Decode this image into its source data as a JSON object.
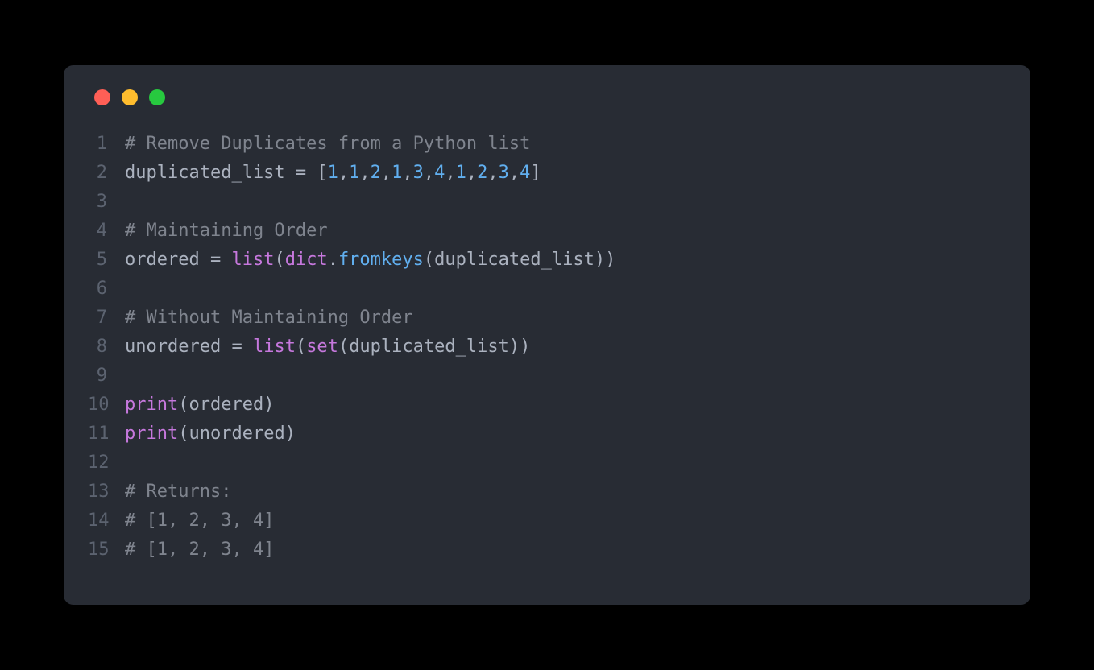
{
  "code": {
    "lines": [
      {
        "num": "1",
        "tokens": [
          {
            "cls": "tok-comment",
            "text": "# Remove Duplicates from a Python list"
          }
        ]
      },
      {
        "num": "2",
        "tokens": [
          {
            "cls": "tok-identifier",
            "text": "duplicated_list "
          },
          {
            "cls": "tok-operator",
            "text": "= "
          },
          {
            "cls": "tok-bracket",
            "text": "["
          },
          {
            "cls": "tok-number",
            "text": "1"
          },
          {
            "cls": "tok-operator",
            "text": ","
          },
          {
            "cls": "tok-number",
            "text": "1"
          },
          {
            "cls": "tok-operator",
            "text": ","
          },
          {
            "cls": "tok-number",
            "text": "2"
          },
          {
            "cls": "tok-operator",
            "text": ","
          },
          {
            "cls": "tok-number",
            "text": "1"
          },
          {
            "cls": "tok-operator",
            "text": ","
          },
          {
            "cls": "tok-number",
            "text": "3"
          },
          {
            "cls": "tok-operator",
            "text": ","
          },
          {
            "cls": "tok-number",
            "text": "4"
          },
          {
            "cls": "tok-operator",
            "text": ","
          },
          {
            "cls": "tok-number",
            "text": "1"
          },
          {
            "cls": "tok-operator",
            "text": ","
          },
          {
            "cls": "tok-number",
            "text": "2"
          },
          {
            "cls": "tok-operator",
            "text": ","
          },
          {
            "cls": "tok-number",
            "text": "3"
          },
          {
            "cls": "tok-operator",
            "text": ","
          },
          {
            "cls": "tok-number",
            "text": "4"
          },
          {
            "cls": "tok-bracket",
            "text": "]"
          }
        ]
      },
      {
        "num": "3",
        "tokens": []
      },
      {
        "num": "4",
        "tokens": [
          {
            "cls": "tok-comment",
            "text": "# Maintaining Order"
          }
        ]
      },
      {
        "num": "5",
        "tokens": [
          {
            "cls": "tok-identifier",
            "text": "ordered "
          },
          {
            "cls": "tok-operator",
            "text": "= "
          },
          {
            "cls": "tok-builtin",
            "text": "list"
          },
          {
            "cls": "tok-bracket",
            "text": "("
          },
          {
            "cls": "tok-builtin",
            "text": "dict"
          },
          {
            "cls": "tok-dot",
            "text": "."
          },
          {
            "cls": "tok-function",
            "text": "fromkeys"
          },
          {
            "cls": "tok-bracket",
            "text": "("
          },
          {
            "cls": "tok-identifier",
            "text": "duplicated_list"
          },
          {
            "cls": "tok-bracket",
            "text": "))"
          }
        ]
      },
      {
        "num": "6",
        "tokens": []
      },
      {
        "num": "7",
        "tokens": [
          {
            "cls": "tok-comment",
            "text": "# Without Maintaining Order"
          }
        ]
      },
      {
        "num": "8",
        "tokens": [
          {
            "cls": "tok-identifier",
            "text": "unordered "
          },
          {
            "cls": "tok-operator",
            "text": "= "
          },
          {
            "cls": "tok-builtin",
            "text": "list"
          },
          {
            "cls": "tok-bracket",
            "text": "("
          },
          {
            "cls": "tok-builtin",
            "text": "set"
          },
          {
            "cls": "tok-bracket",
            "text": "("
          },
          {
            "cls": "tok-identifier",
            "text": "duplicated_list"
          },
          {
            "cls": "tok-bracket",
            "text": "))"
          }
        ]
      },
      {
        "num": "9",
        "tokens": []
      },
      {
        "num": "10",
        "tokens": [
          {
            "cls": "tok-print",
            "text": "print"
          },
          {
            "cls": "tok-bracket",
            "text": "("
          },
          {
            "cls": "tok-identifier",
            "text": "ordered"
          },
          {
            "cls": "tok-bracket",
            "text": ")"
          }
        ]
      },
      {
        "num": "11",
        "tokens": [
          {
            "cls": "tok-print",
            "text": "print"
          },
          {
            "cls": "tok-bracket",
            "text": "("
          },
          {
            "cls": "tok-identifier",
            "text": "unordered"
          },
          {
            "cls": "tok-bracket",
            "text": ")"
          }
        ]
      },
      {
        "num": "12",
        "tokens": []
      },
      {
        "num": "13",
        "tokens": [
          {
            "cls": "tok-comment",
            "text": "# Returns:"
          }
        ]
      },
      {
        "num": "14",
        "tokens": [
          {
            "cls": "tok-comment",
            "text": "# [1, 2, 3, 4]"
          }
        ]
      },
      {
        "num": "15",
        "tokens": [
          {
            "cls": "tok-comment",
            "text": "# [1, 2, 3, 4]"
          }
        ]
      }
    ]
  }
}
